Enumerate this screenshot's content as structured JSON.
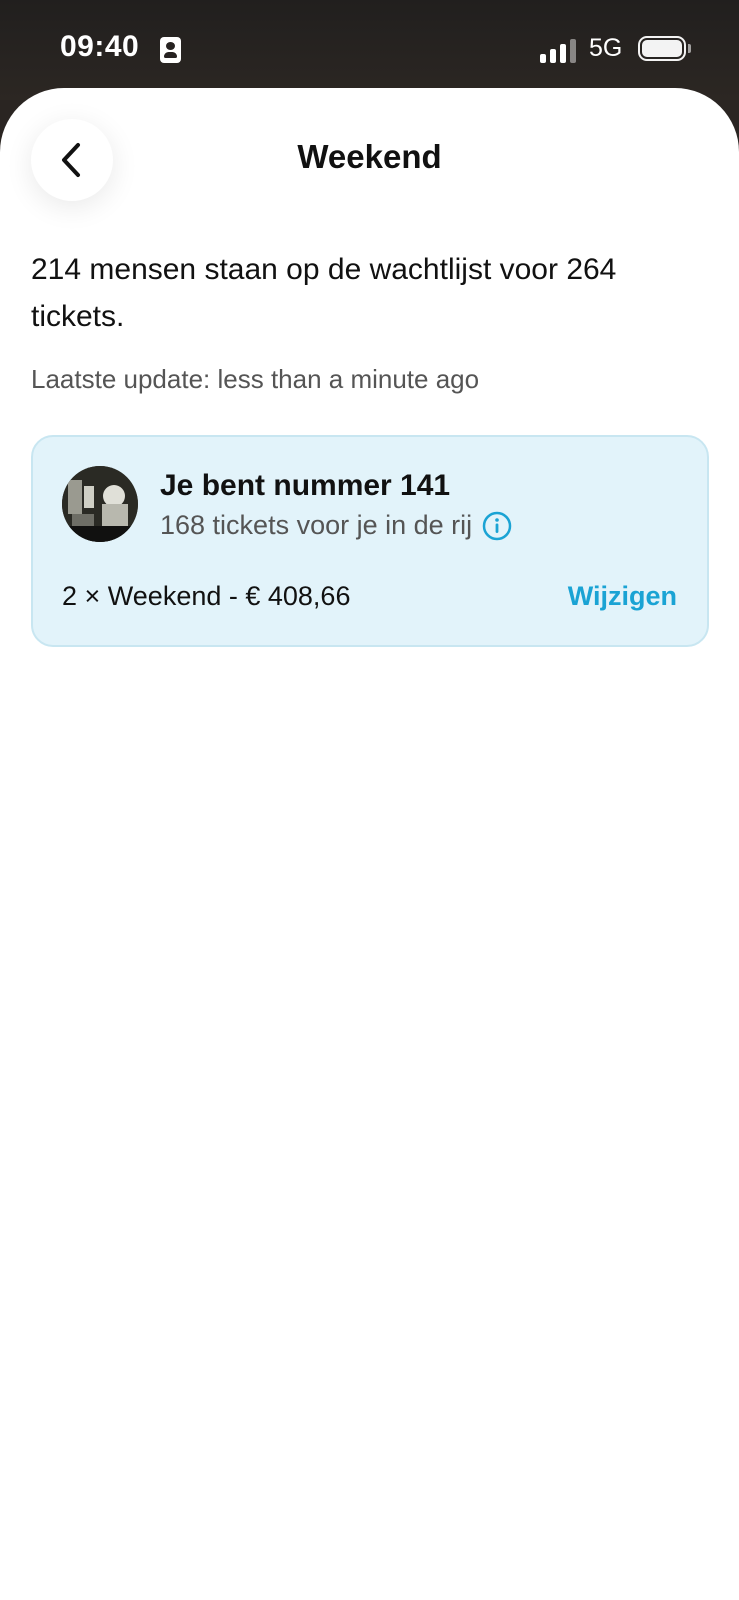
{
  "status_bar": {
    "time": "09:40",
    "network": "5G",
    "icons": [
      "contact-card-icon",
      "signal-icon",
      "battery-icon"
    ]
  },
  "header": {
    "title": "Weekend",
    "back_icon": "chevron-left-icon"
  },
  "waitlist": {
    "summary": "214 mensen staan op de wachtlijst voor 264 tickets.",
    "last_update": "Laatste update: less than a minute ago"
  },
  "queue_card": {
    "title": "Je bent nummer 141",
    "subtitle": "168 tickets voor je in de rij",
    "info_icon": "info-icon",
    "order_summary": "2 × Weekend - € 408,66",
    "edit_label": "Wijzigen"
  },
  "colors": {
    "accent": "#1aa3d4",
    "card_background": "#e2f3fa",
    "card_border": "#c8e6f1"
  }
}
